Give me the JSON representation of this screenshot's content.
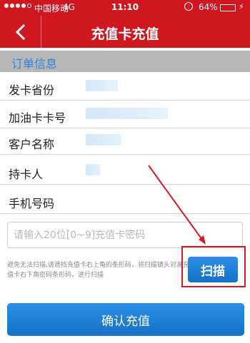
{
  "status_bar": {
    "carrier": "中国移动",
    "network": "4G",
    "time": "11:10",
    "battery_percent": "64%",
    "battery_level": 0.64
  },
  "nav": {
    "title": "充值卡充值",
    "back_icon": "chevron-left-icon"
  },
  "section": {
    "title": "订单信息"
  },
  "fields": [
    {
      "label": "发卡省份"
    },
    {
      "label": "加油卡卡号"
    },
    {
      "label": "客户名称"
    },
    {
      "label": "持卡人"
    },
    {
      "label": "手机号码"
    }
  ],
  "card_password": {
    "placeholder": "请输入20位[0~9]充值卡密码",
    "value": ""
  },
  "hint": "避免无法扫描,请遮挡充值卡右上角的条形码，将扫描镜头对准充值卡右下角密码条形码，进行扫描",
  "scan_button": {
    "label": "扫描"
  },
  "confirm_button": {
    "label": "确认充值"
  },
  "colors": {
    "brand_red": "#d0161f",
    "accent_blue": "#1472c8",
    "section_gray": "#b7b7b7",
    "annotation_red": "#d7191f"
  }
}
